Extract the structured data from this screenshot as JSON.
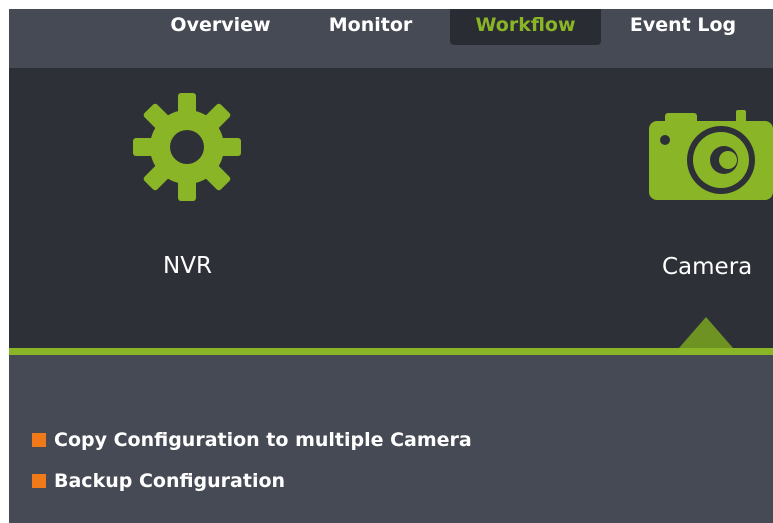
{
  "nav": {
    "tabs": [
      {
        "label": "Overview"
      },
      {
        "label": "Monitor"
      },
      {
        "label": "Workflow",
        "active": true
      },
      {
        "label": "Event Log"
      }
    ]
  },
  "devices": [
    {
      "label": "NVR",
      "icon": "gear-icon"
    },
    {
      "label": "Camera",
      "icon": "camera-icon",
      "selected": true
    }
  ],
  "actions": [
    {
      "label": "Copy Configuration to multiple Camera"
    },
    {
      "label": "Backup Configuration"
    }
  ],
  "colors": {
    "accent": "#8ab527",
    "bullet": "#f07a1a",
    "nav_bg": "#464a54",
    "panel_bg": "#2e3038"
  }
}
